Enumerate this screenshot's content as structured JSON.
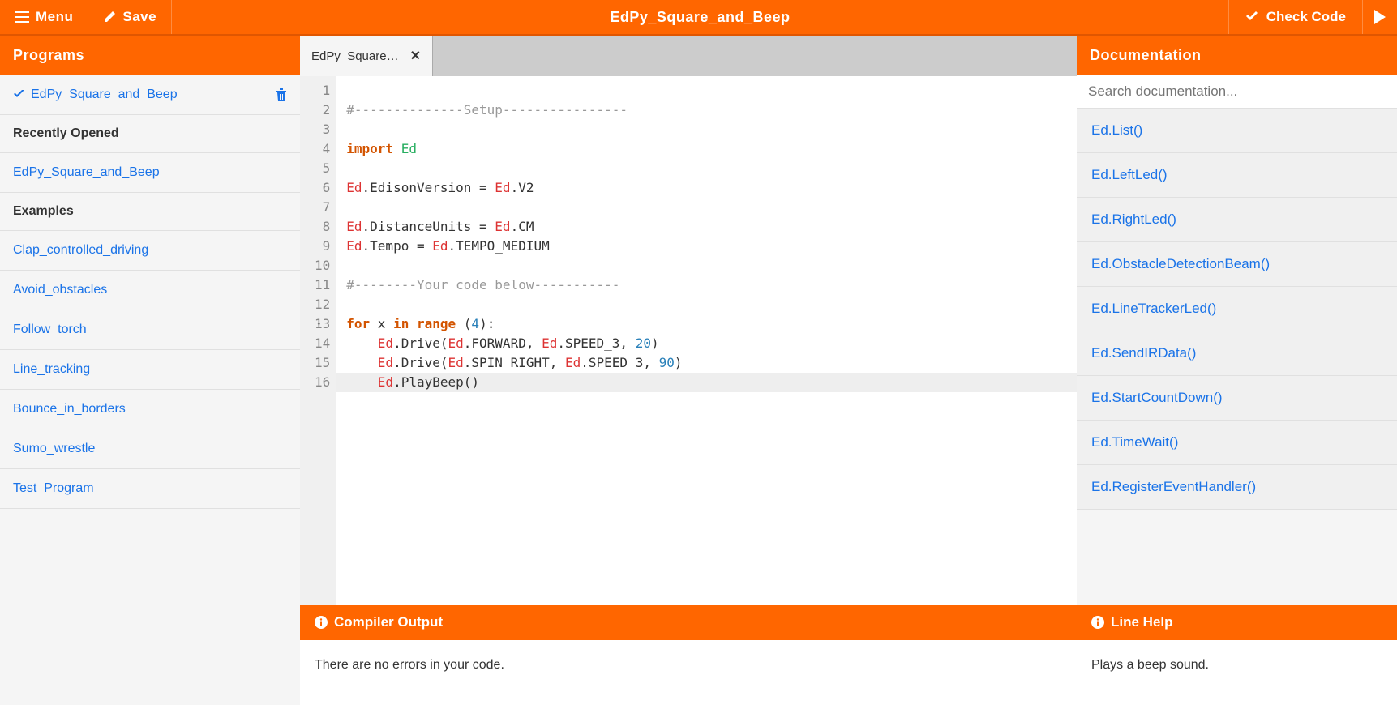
{
  "topbar": {
    "menu": "Menu",
    "save": "Save",
    "title": "EdPy_Square_and_Beep",
    "check_code": "Check Code"
  },
  "left": {
    "header": "Programs",
    "current_checked": "EdPy_Square_and_Beep",
    "recently_header": "Recently Opened",
    "recently": [
      "EdPy_Square_and_Beep"
    ],
    "examples_header": "Examples",
    "examples": [
      "Clap_controlled_driving",
      "Avoid_obstacles",
      "Follow_torch",
      "Line_tracking",
      "Bounce_in_borders",
      "Sumo_wrestle",
      "Test_Program"
    ]
  },
  "editor": {
    "tab_label": "EdPy_Square…",
    "lines": [
      {
        "n": 1,
        "raw": ""
      },
      {
        "n": 2,
        "tokens": [
          [
            "comment",
            "#--------------Setup----------------"
          ]
        ]
      },
      {
        "n": 3,
        "raw": ""
      },
      {
        "n": 4,
        "tokens": [
          [
            "keyword",
            "import"
          ],
          [
            "default",
            " "
          ],
          [
            "module",
            "Ed"
          ]
        ]
      },
      {
        "n": 5,
        "raw": ""
      },
      {
        "n": 6,
        "tokens": [
          [
            "name",
            "Ed"
          ],
          [
            "default",
            ".EdisonVersion = "
          ],
          [
            "name",
            "Ed"
          ],
          [
            "default",
            ".V2"
          ]
        ]
      },
      {
        "n": 7,
        "raw": ""
      },
      {
        "n": 8,
        "tokens": [
          [
            "name",
            "Ed"
          ],
          [
            "default",
            ".DistanceUnits = "
          ],
          [
            "name",
            "Ed"
          ],
          [
            "default",
            ".CM"
          ]
        ]
      },
      {
        "n": 9,
        "tokens": [
          [
            "name",
            "Ed"
          ],
          [
            "default",
            ".Tempo = "
          ],
          [
            "name",
            "Ed"
          ],
          [
            "default",
            ".TEMPO_MEDIUM"
          ]
        ]
      },
      {
        "n": 10,
        "raw": ""
      },
      {
        "n": 11,
        "tokens": [
          [
            "comment",
            "#--------Your code below-----------"
          ]
        ]
      },
      {
        "n": 12,
        "raw": ""
      },
      {
        "n": 13,
        "fold": true,
        "tokens": [
          [
            "keyword",
            "for"
          ],
          [
            "default",
            " x "
          ],
          [
            "keyword",
            "in"
          ],
          [
            "default",
            " "
          ],
          [
            "keyword",
            "range"
          ],
          [
            "default",
            " ("
          ],
          [
            "number",
            "4"
          ],
          [
            "default",
            "):"
          ]
        ]
      },
      {
        "n": 14,
        "tokens": [
          [
            "default",
            "    "
          ],
          [
            "name",
            "Ed"
          ],
          [
            "default",
            ".Drive("
          ],
          [
            "name",
            "Ed"
          ],
          [
            "default",
            ".FORWARD, "
          ],
          [
            "name",
            "Ed"
          ],
          [
            "default",
            ".SPEED_3, "
          ],
          [
            "number",
            "20"
          ],
          [
            "default",
            ")"
          ]
        ]
      },
      {
        "n": 15,
        "tokens": [
          [
            "default",
            "    "
          ],
          [
            "name",
            "Ed"
          ],
          [
            "default",
            ".Drive("
          ],
          [
            "name",
            "Ed"
          ],
          [
            "default",
            ".SPIN_RIGHT, "
          ],
          [
            "name",
            "Ed"
          ],
          [
            "default",
            ".SPEED_3, "
          ],
          [
            "number",
            "90"
          ],
          [
            "default",
            ")"
          ]
        ]
      },
      {
        "n": 16,
        "hl": true,
        "tokens": [
          [
            "default",
            "    "
          ],
          [
            "name",
            "Ed"
          ],
          [
            "default",
            ".PlayBeep()"
          ]
        ]
      }
    ]
  },
  "compiler": {
    "header": "Compiler Output",
    "message": "There are no errors in your code."
  },
  "docs": {
    "header": "Documentation",
    "search_placeholder": "Search documentation...",
    "items": [
      "Ed.List()",
      "Ed.LeftLed()",
      "Ed.RightLed()",
      "Ed.ObstacleDetectionBeam()",
      "Ed.LineTrackerLed()",
      "Ed.SendIRData()",
      "Ed.StartCountDown()",
      "Ed.TimeWait()",
      "Ed.RegisterEventHandler()"
    ],
    "line_help_header": "Line Help",
    "line_help_body": "Plays a beep sound."
  }
}
